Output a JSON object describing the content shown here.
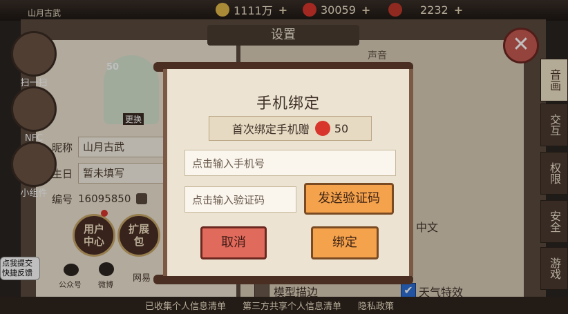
{
  "top_bar": {
    "player_name": "山月古武",
    "resources": [
      {
        "icon": "coin-icon",
        "value": "1111万",
        "color": "#e2b94a"
      },
      {
        "icon": "red-ticket-icon",
        "value": "30059",
        "color": "#d8362c"
      },
      {
        "icon": "gem-icon",
        "value": "2232",
        "color": "#c0392b"
      }
    ]
  },
  "settings": {
    "title": "设置",
    "side_buttons": [
      "扫一扫",
      "NFC",
      "小组件"
    ],
    "avatar_level": "50",
    "avatar_change_label": "更换",
    "nickname_label": "昵称",
    "nickname_value": "山月古武",
    "birthday_label": "生日",
    "birthday_value": "暂未填写",
    "id_label": "编号",
    "id_value": "16095850",
    "user_center_label": "用户中心",
    "expansion_label": "扩展包",
    "feedback_label": "点我提交快捷反馈",
    "social": [
      {
        "icon": "wechat-icon",
        "label": "公众号"
      },
      {
        "icon": "weibo-icon",
        "label": "微博"
      }
    ],
    "network_label": "网易",
    "right_header": "声音",
    "language_value": "中文",
    "checkboxes": [
      {
        "label": "模型描边",
        "checked": false
      },
      {
        "label": "天气特效",
        "checked": true
      }
    ],
    "tabs": [
      "音画",
      "交互",
      "权限",
      "安全",
      "游戏"
    ],
    "active_tab": "音画",
    "bottom_links": [
      "已收集个人信息清单",
      "第三方共享个人信息清单",
      "隐私政策"
    ]
  },
  "modal": {
    "title": "手机绑定",
    "bonus_text": "首次绑定手机赠",
    "bonus_amount": "50",
    "phone_placeholder": "点击输入手机号",
    "code_placeholder": "点击输入验证码",
    "send_code_label": "发送验证码",
    "cancel_label": "取消",
    "bind_label": "绑定"
  }
}
